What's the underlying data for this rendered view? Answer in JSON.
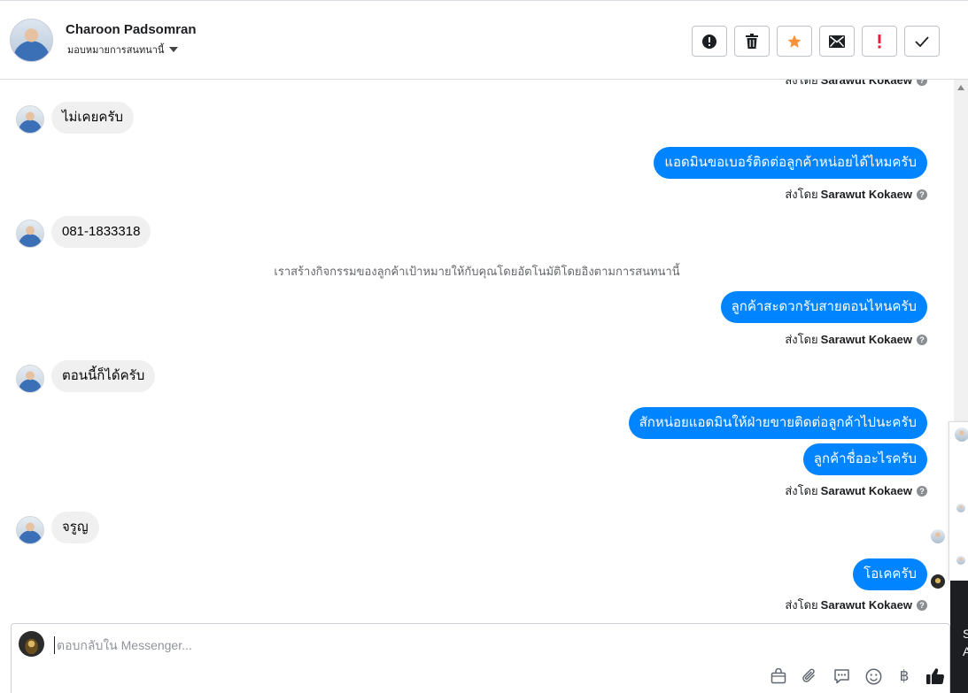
{
  "header": {
    "contact_name": "Charoon Padsomran",
    "assign_label": "มอบหมายการสนทนานี้",
    "tools": [
      {
        "name": "spam-button",
        "icon": "alert-circle-icon"
      },
      {
        "name": "delete-button",
        "icon": "trash-icon"
      },
      {
        "name": "star-button",
        "icon": "star-icon"
      },
      {
        "name": "mark-unread-button",
        "icon": "envelope-icon"
      },
      {
        "name": "follow-up-button",
        "icon": "exclamation-icon"
      },
      {
        "name": "mark-done-button",
        "icon": "checkmark-icon"
      }
    ]
  },
  "thread": {
    "top_partial_sent_by": "ส่งโดย",
    "top_partial_sender": "Sarawut Kokaew",
    "messages": [
      {
        "direction": "in",
        "text": "ไม่เคยครับ"
      },
      {
        "direction": "out",
        "text": "แอดมินขอเบอร์ติดต่อลูกค้าหน่อยได้ไหมครับ"
      },
      {
        "direction": "in",
        "text": "081-1833318"
      },
      {
        "direction": "out",
        "text": "ลูกค้าสะดวกรับสายตอนไหนครับ"
      },
      {
        "direction": "in",
        "text": "ตอนนี้ก็ได้ครับ"
      },
      {
        "direction": "out",
        "text": "สักหน่อยแอดมินให้ฝ่ายขายติดต่อลูกค้าไปนะครับ"
      },
      {
        "direction": "out",
        "text": "ลูกค้าชื่ออะไรครับ"
      },
      {
        "direction": "in",
        "text": "จรูญ"
      },
      {
        "direction": "out",
        "text": "โอเคครับ"
      }
    ],
    "system_note": "เราสร้างกิจกรรมของลูกค้าเป้าหมายให้กับคุณโดยอัตโนมัติโดยอิงตามการสนทนานี้",
    "sent_by_label": "ส่งโดย",
    "sender_name": "Sarawut Kokaew",
    "help_glyph": "?"
  },
  "side_panel": {
    "dark_text_1": "S",
    "dark_text_2": "A"
  },
  "composer": {
    "placeholder": "ตอบกลับใน Messenger...",
    "value": "",
    "tools": [
      "shopping-bag-icon",
      "paperclip-icon",
      "chat-bubble-icon",
      "smiley-icon",
      "baht-icon",
      "thumbs-up-icon"
    ],
    "baht_glyph": "฿"
  },
  "colors": {
    "outgoing_bubble": "#0084ff",
    "incoming_bubble": "#f0f0f0",
    "star": "#f7923a",
    "follow_up": "#e41e3f"
  }
}
